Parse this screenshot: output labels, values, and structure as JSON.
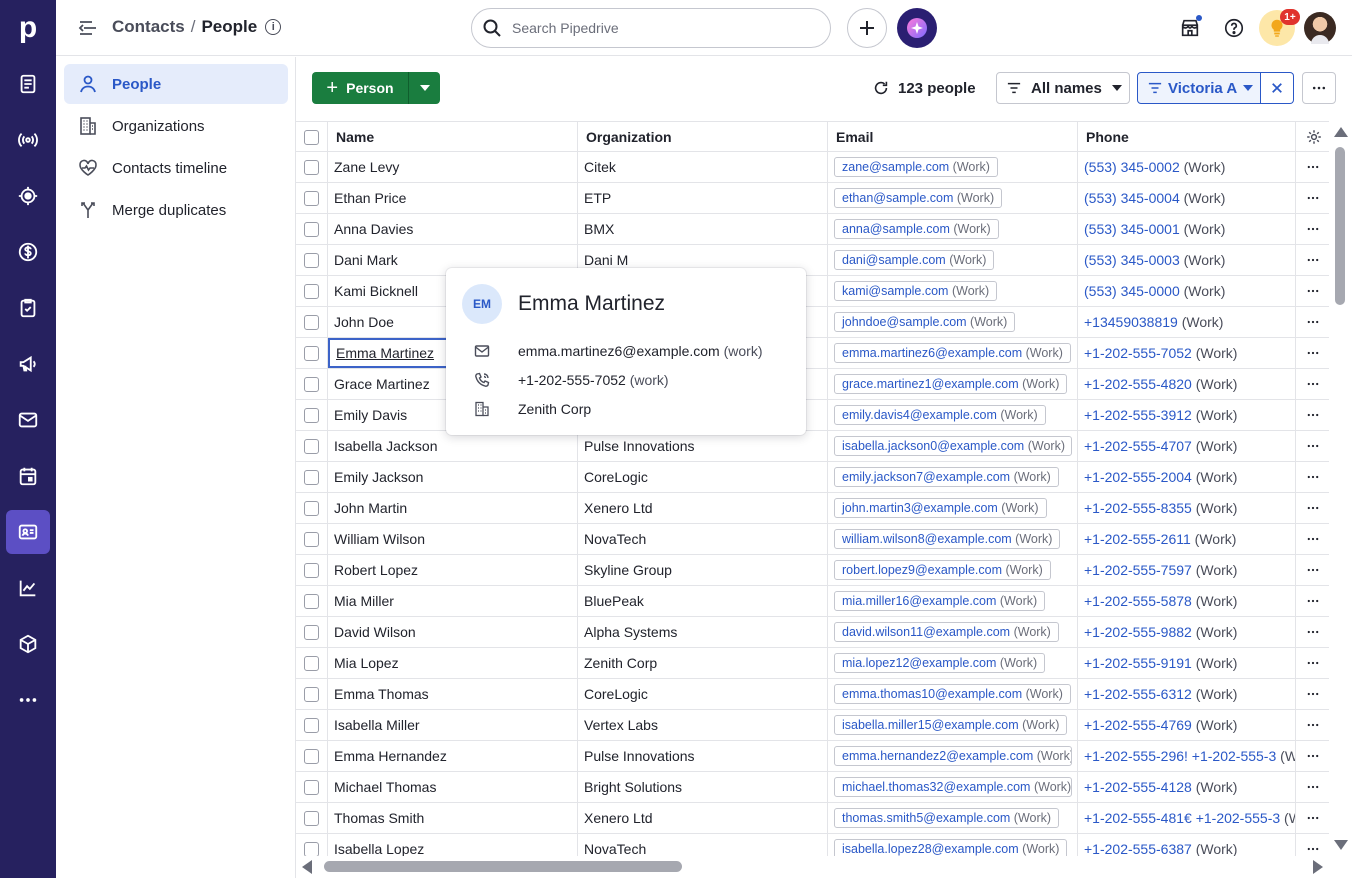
{
  "app": {
    "logo": "p"
  },
  "rail": {
    "items": [
      {
        "icon": "deals-icon"
      },
      {
        "icon": "leads-icon"
      },
      {
        "icon": "target-icon"
      },
      {
        "icon": "dollar-icon"
      },
      {
        "icon": "tasks-icon"
      },
      {
        "icon": "campaigns-icon"
      },
      {
        "icon": "mail-icon"
      },
      {
        "icon": "calendar-icon"
      },
      {
        "icon": "contacts-icon",
        "active": true
      },
      {
        "icon": "insights-icon"
      },
      {
        "icon": "products-icon"
      },
      {
        "icon": "more-icon"
      }
    ]
  },
  "header": {
    "breadcrumb_parent": "Contacts",
    "breadcrumb_sep": "/",
    "breadcrumb_current": "People",
    "info_glyph": "i",
    "search_placeholder": "Search Pipedrive",
    "notification_badge": "1+"
  },
  "sidebar": {
    "items": [
      {
        "label": "People",
        "icon": "person-icon",
        "active": true
      },
      {
        "label": "Organizations",
        "icon": "building-icon"
      },
      {
        "label": "Contacts timeline",
        "icon": "heartbeat-icon"
      },
      {
        "label": "Merge duplicates",
        "icon": "merge-icon"
      }
    ]
  },
  "toolbar": {
    "add_person_label": "Person",
    "people_count": "123 people",
    "filter_label": "All names",
    "owner_filter_label": "Victoria A"
  },
  "table": {
    "columns": [
      "Name",
      "Organization",
      "Email",
      "Phone"
    ],
    "work_label": "(Work)",
    "rows": [
      {
        "name": "Zane Levy",
        "org": "Citek",
        "email": "zane@sample.com",
        "phone": "(553) 345-0002"
      },
      {
        "name": "Ethan Price",
        "org": "ETP",
        "email": "ethan@sample.com",
        "phone": "(553) 345-0004"
      },
      {
        "name": "Anna Davies",
        "org": "BMX",
        "email": "anna@sample.com",
        "phone": "(553) 345-0001"
      },
      {
        "name": "Dani Mark",
        "org": "Dani M",
        "email": "dani@sample.com",
        "phone": "(553) 345-0003"
      },
      {
        "name": "Kami Bicknell",
        "org": "",
        "email": "kami@sample.com",
        "phone": "(553) 345-0000"
      },
      {
        "name": "John Doe",
        "org": "",
        "email": "johndoe@sample.com",
        "phone": "+13459038819"
      },
      {
        "name": "Emma Martinez",
        "org": "",
        "email": "emma.martinez6@example.com",
        "phone": "+1-202-555-7052",
        "selected": true
      },
      {
        "name": "Grace Martinez",
        "org": "",
        "email": "grace.martinez1@example.com",
        "phone": "+1-202-555-4820"
      },
      {
        "name": "Emily Davis",
        "org": "",
        "email": "emily.davis4@example.com",
        "phone": "+1-202-555-3912"
      },
      {
        "name": "Isabella Jackson",
        "org": "Pulse Innovations",
        "email": "isabella.jackson0@example.com",
        "phone": "+1-202-555-4707"
      },
      {
        "name": "Emily Jackson",
        "org": "CoreLogic",
        "email": "emily.jackson7@example.com",
        "phone": "+1-202-555-2004"
      },
      {
        "name": "John Martin",
        "org": "Xenero Ltd",
        "email": "john.martin3@example.com",
        "phone": "+1-202-555-8355"
      },
      {
        "name": "William Wilson",
        "org": "NovaTech",
        "email": "william.wilson8@example.com",
        "phone": "+1-202-555-2611"
      },
      {
        "name": "Robert Lopez",
        "org": "Skyline Group",
        "email": "robert.lopez9@example.com",
        "phone": "+1-202-555-7597"
      },
      {
        "name": "Mia Miller",
        "org": "BluePeak",
        "email": "mia.miller16@example.com",
        "phone": "+1-202-555-5878"
      },
      {
        "name": "David Wilson",
        "org": "Alpha Systems",
        "email": "david.wilson11@example.com",
        "phone": "+1-202-555-9882"
      },
      {
        "name": "Mia Lopez",
        "org": "Zenith Corp",
        "email": "mia.lopez12@example.com",
        "phone": "+1-202-555-9191"
      },
      {
        "name": "Emma Thomas",
        "org": "CoreLogic",
        "email": "emma.thomas10@example.com",
        "phone": "+1-202-555-6312"
      },
      {
        "name": "Isabella Miller",
        "org": "Vertex Labs",
        "email": "isabella.miller15@example.com",
        "phone": "+1-202-555-4769"
      },
      {
        "name": "Emma Hernandez",
        "org": "Pulse Innovations",
        "email": "emma.hernandez2@example.com",
        "phone": "+1-202-555-296! +1-202-555-3"
      },
      {
        "name": "Michael Thomas",
        "org": "Bright Solutions",
        "email": "michael.thomas32@example.com",
        "phone": "+1-202-555-4128"
      },
      {
        "name": "Thomas Smith",
        "org": "Xenero Ltd",
        "email": "thomas.smith5@example.com",
        "phone": "+1-202-555-481€ +1-202-555-3"
      },
      {
        "name": "Isabella Lopez",
        "org": "NovaTech",
        "email": "isabella.lopez28@example.com",
        "phone": "+1-202-555-6387"
      }
    ]
  },
  "popover": {
    "initials": "EM",
    "name": "Emma Martinez",
    "email": "emma.martinez6@example.com",
    "email_type": "(work)",
    "phone": "+1-202-555-7052",
    "phone_type": "(work)",
    "organization": "Zenith Corp"
  },
  "colors": {
    "rail_bg": "#26215f",
    "rail_active": "#5c4fc4",
    "primary_green": "#1a7d3f",
    "link_blue": "#2a58c7"
  }
}
